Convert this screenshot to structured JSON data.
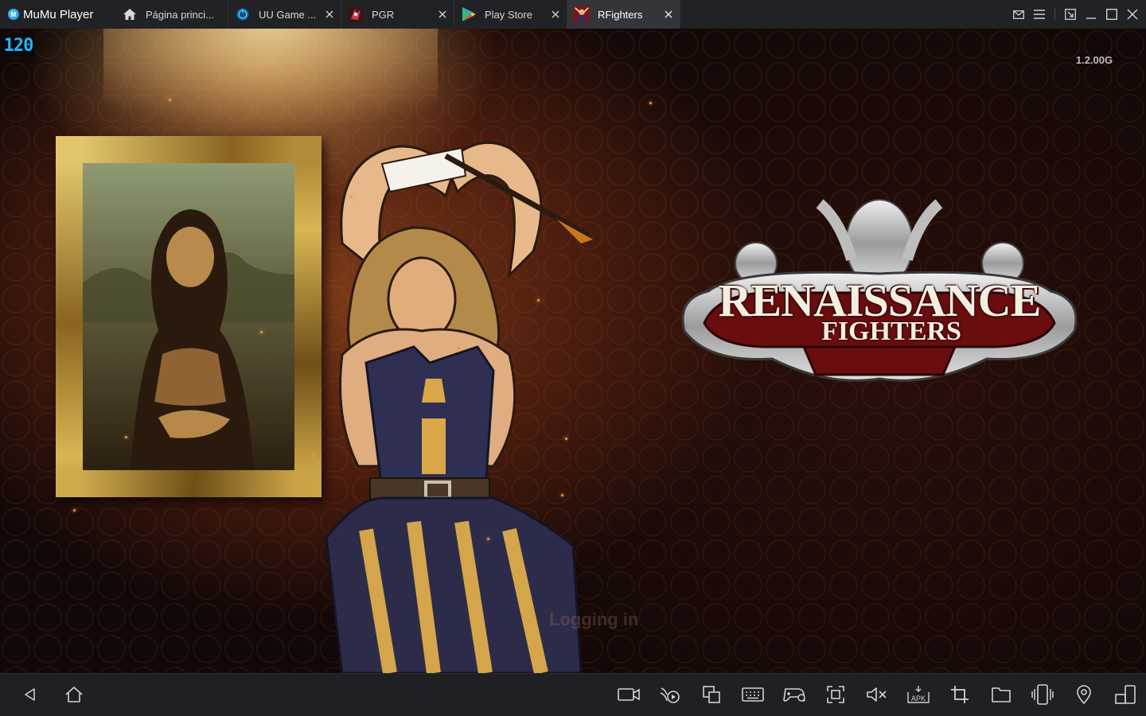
{
  "app": {
    "title": "MuMu Player",
    "logo_glyph": "M"
  },
  "tabs": [
    {
      "label": "Página princi...",
      "icon": "home-icon",
      "active": false,
      "closable": false
    },
    {
      "label": "UU Game ...",
      "icon": "uu-accelerator-icon",
      "active": false,
      "closable": true
    },
    {
      "label": "PGR",
      "icon": "pgr-app-icon",
      "active": false,
      "closable": true
    },
    {
      "label": "Play Store",
      "icon": "play-store-icon",
      "active": false,
      "closable": true
    },
    {
      "label": "RFighters",
      "icon": "rfighters-app-icon",
      "active": true,
      "closable": true
    }
  ],
  "window_controls": [
    "mail-icon",
    "menu-icon",
    "restore-window-icon",
    "minimize-icon",
    "maximize-icon",
    "close-icon"
  ],
  "game": {
    "fps": "120",
    "version": "1.2.00G",
    "logo_title": "RENAISSANCE",
    "logo_subtitle": "FIGHTERS",
    "loading_text": "Logging in"
  },
  "bottom_bar": {
    "left": [
      "back-icon",
      "home-icon"
    ],
    "right": [
      "screen-record-icon",
      "operation-record-icon",
      "multi-instance-icon",
      "keyboard-mapping-icon",
      "gamepad-icon",
      "screenshot-icon",
      "mute-icon",
      "install-apk-icon",
      "crop-icon",
      "shared-folder-icon",
      "shake-icon",
      "location-icon",
      "rotate-screen-icon"
    ],
    "apk_label": "APK"
  },
  "colors": {
    "titlebar": "#202226",
    "active_tab": "#33353a",
    "fps_text": "#25b3ff",
    "bottombar": "#1e2024"
  }
}
